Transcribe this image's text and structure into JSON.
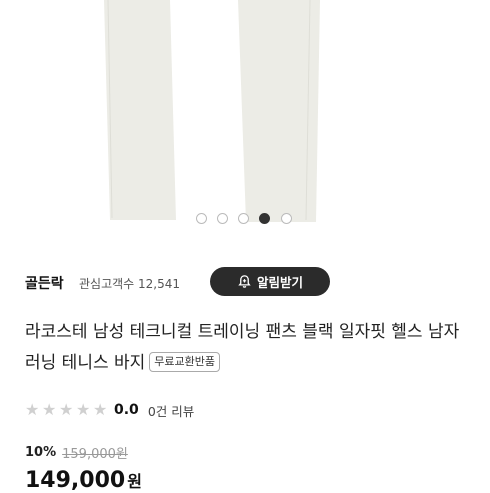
{
  "product_image": {
    "carousel": {
      "total": 5,
      "active_index": 3
    }
  },
  "seller": {
    "name": "골든락",
    "follower_label": "관심고객수 12,541",
    "alarm_button_label": "알림받기",
    "alarm_icon": "bell-plus-icon"
  },
  "product": {
    "title": "라코스테 남성 테크니컬 트레이닝 팬츠 블랙 일자핏 헬스 남자 러닝 테니스 바지",
    "badge": "무료교환반품"
  },
  "rating": {
    "score": "0.0",
    "stars_filled": 0,
    "stars_total": 5,
    "reviews_label": "0건 리뷰"
  },
  "price": {
    "discount": "10%",
    "original": "159,000원",
    "final": "149,000",
    "currency": "원"
  }
}
